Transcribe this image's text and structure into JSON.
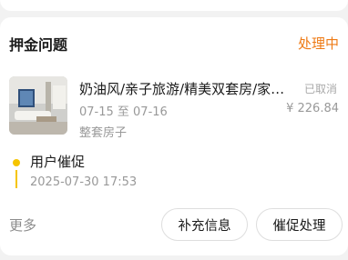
{
  "section": {
    "title": "押金问题",
    "status": "处理中"
  },
  "listing": {
    "title": "奶油风/亲子旅游/精美双套房/家…",
    "dates": "07-15 至 07-16",
    "room_type": "整套房子",
    "order_status": "已取消",
    "price": "¥ 226.84"
  },
  "timeline": {
    "event": "用户催促",
    "time": "2025-07-30 17:53"
  },
  "footer": {
    "more_label": "更多",
    "supplement_label": "补充信息",
    "urge_label": "催促处理"
  },
  "colors": {
    "accent": "#ee7a14",
    "timeline": "#f5c400"
  }
}
